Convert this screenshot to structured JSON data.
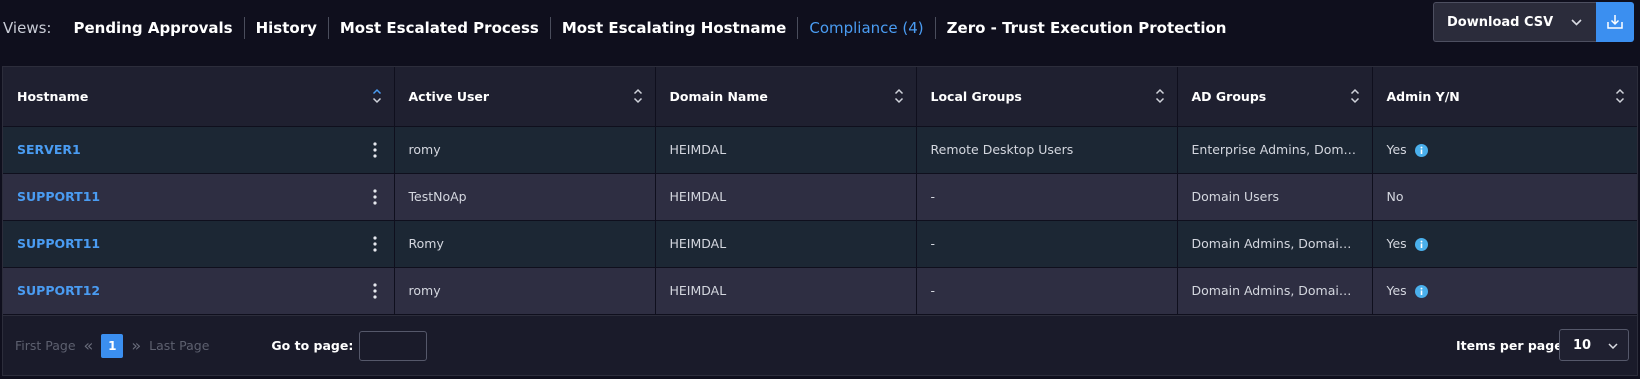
{
  "views": {
    "label": "Views:",
    "tabs": [
      {
        "label": "Pending Approvals"
      },
      {
        "label": "History"
      },
      {
        "label": "Most Escalated Process"
      },
      {
        "label": "Most Escalating Hostname"
      },
      {
        "label": "Compliance (4)",
        "active": true
      },
      {
        "label": "Zero - Trust Execution Protection"
      }
    ]
  },
  "download": {
    "label": "Download CSV",
    "chevron_icon": "chevron-down-icon",
    "button_icon": "download-icon"
  },
  "table": {
    "columns": [
      {
        "label": "Hostname",
        "sort_active": true
      },
      {
        "label": "Active User"
      },
      {
        "label": "Domain Name"
      },
      {
        "label": "Local Groups"
      },
      {
        "label": "AD Groups"
      },
      {
        "label": "Admin Y/N"
      }
    ],
    "rows": [
      {
        "hostname": "SERVER1",
        "active_user": "romy",
        "domain": "HEIMDAL",
        "local_groups": "Remote Desktop Users",
        "ad_groups": "Enterprise Admins, Domain A...",
        "admin": "Yes",
        "admin_info": true
      },
      {
        "hostname": "SUPPORT11",
        "active_user": "TestNoAp",
        "domain": "HEIMDAL",
        "local_groups": "-",
        "ad_groups": "Domain Users",
        "admin": "No",
        "admin_info": false
      },
      {
        "hostname": "SUPPORT11",
        "active_user": "Romy",
        "domain": "HEIMDAL",
        "local_groups": "-",
        "ad_groups": "Domain Admins, Domain Users",
        "admin": "Yes",
        "admin_info": true
      },
      {
        "hostname": "SUPPORT12",
        "active_user": "romy",
        "domain": "HEIMDAL",
        "local_groups": "-",
        "ad_groups": "Domain Admins, Domain Users",
        "admin": "Yes",
        "admin_info": true
      }
    ]
  },
  "pagination": {
    "first": "First Page",
    "last": "Last Page",
    "current_page": "1",
    "goto_label": "Go to page:",
    "goto_value": "",
    "items_per_page_label": "Items per page:",
    "items_per_page": "10"
  },
  "colors": {
    "accent": "#3b8ff0",
    "link": "#4a9cf2",
    "background": "#0f0f1d",
    "row_odd": "#1c2734",
    "row_even": "#2e2e42"
  }
}
